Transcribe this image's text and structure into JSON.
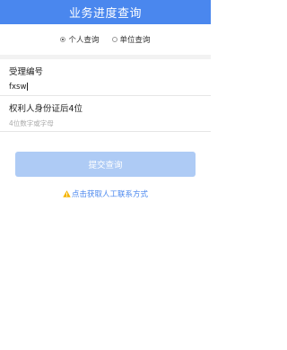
{
  "header": {
    "title": "业务进度查询"
  },
  "query_type": {
    "options": [
      {
        "label": "个人查询",
        "checked": true
      },
      {
        "label": "单位查询",
        "checked": false
      }
    ]
  },
  "form": {
    "acceptance_no": {
      "label": "受理编号",
      "value": "fxsw"
    },
    "id_last4": {
      "label": "权利人身份证后4位",
      "placeholder": "4位数字或字母"
    }
  },
  "submit": {
    "label": "提交查询"
  },
  "contact": {
    "label": "点击获取人工联系方式",
    "icon": "warning-icon"
  },
  "colors": {
    "primary": "#4a87ee",
    "button_disabled": "#aecbf5",
    "warning": "#f5b400"
  }
}
